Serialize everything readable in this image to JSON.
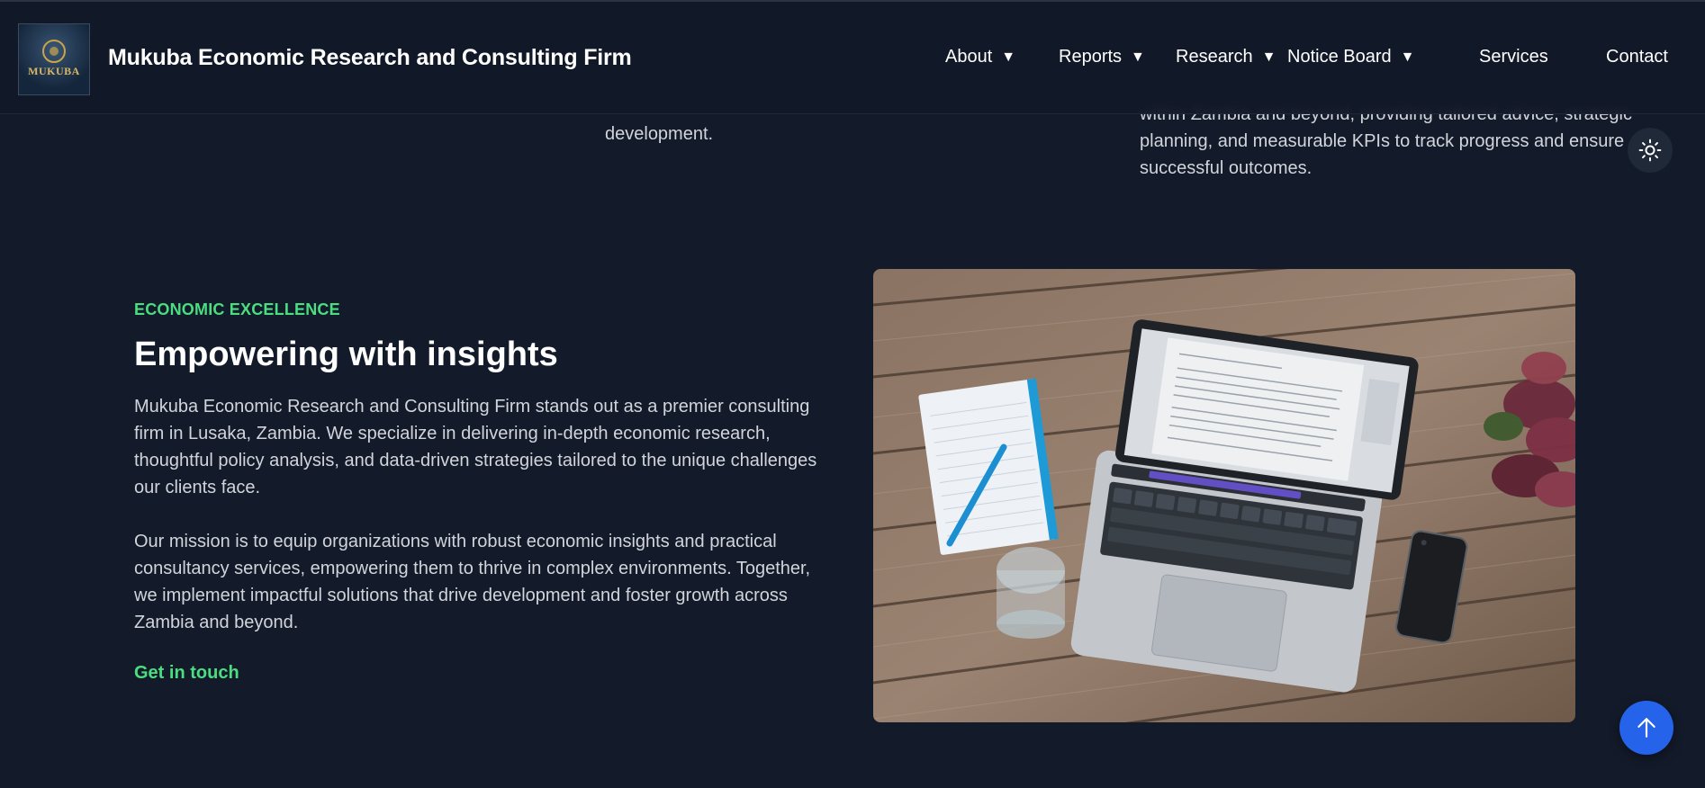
{
  "header": {
    "logo_text": "MUKUBA",
    "brand": "Mukuba Economic Research and Consulting Firm",
    "nav": [
      {
        "label": "About",
        "has_dropdown": true
      },
      {
        "label": "Reports",
        "has_dropdown": true
      },
      {
        "label": "Research",
        "has_dropdown": true
      },
      {
        "label": "Notice Board",
        "has_dropdown": true
      },
      {
        "label": "Services",
        "has_dropdown": false
      },
      {
        "label": "Contact",
        "has_dropdown": false
      }
    ],
    "caret": "▼"
  },
  "previous_section": {
    "col2_tail": "development.",
    "col3_tail": "within Zambia and beyond, providing tailored advice, strategic planning, and measurable KPIs to track progress and ensure successful outcomes."
  },
  "main": {
    "eyebrow": "ECONOMIC EXCELLENCE",
    "headline": "Empowering with insights",
    "paragraph_1": "Mukuba Economic Research and Consulting Firm stands out as a premier consulting firm in Lusaka, Zambia. We specialize in delivering in-depth economic research, thoughtful policy analysis, and data-driven strategies tailored to the unique challenges our clients face.",
    "paragraph_2": "Our mission is to equip organizations with robust economic insights and practical consultancy services, empowering them to thrive in complex environments. Together, we implement impactful solutions that drive development and foster growth across Zambia and beyond.",
    "cta": "Get in touch"
  },
  "icons": {
    "theme_toggle": "sun-icon",
    "back_to_top": "arrow-up-icon"
  },
  "colors": {
    "background": "#131a29",
    "accent_green": "#4ade80",
    "accent_blue": "#2563eb"
  }
}
